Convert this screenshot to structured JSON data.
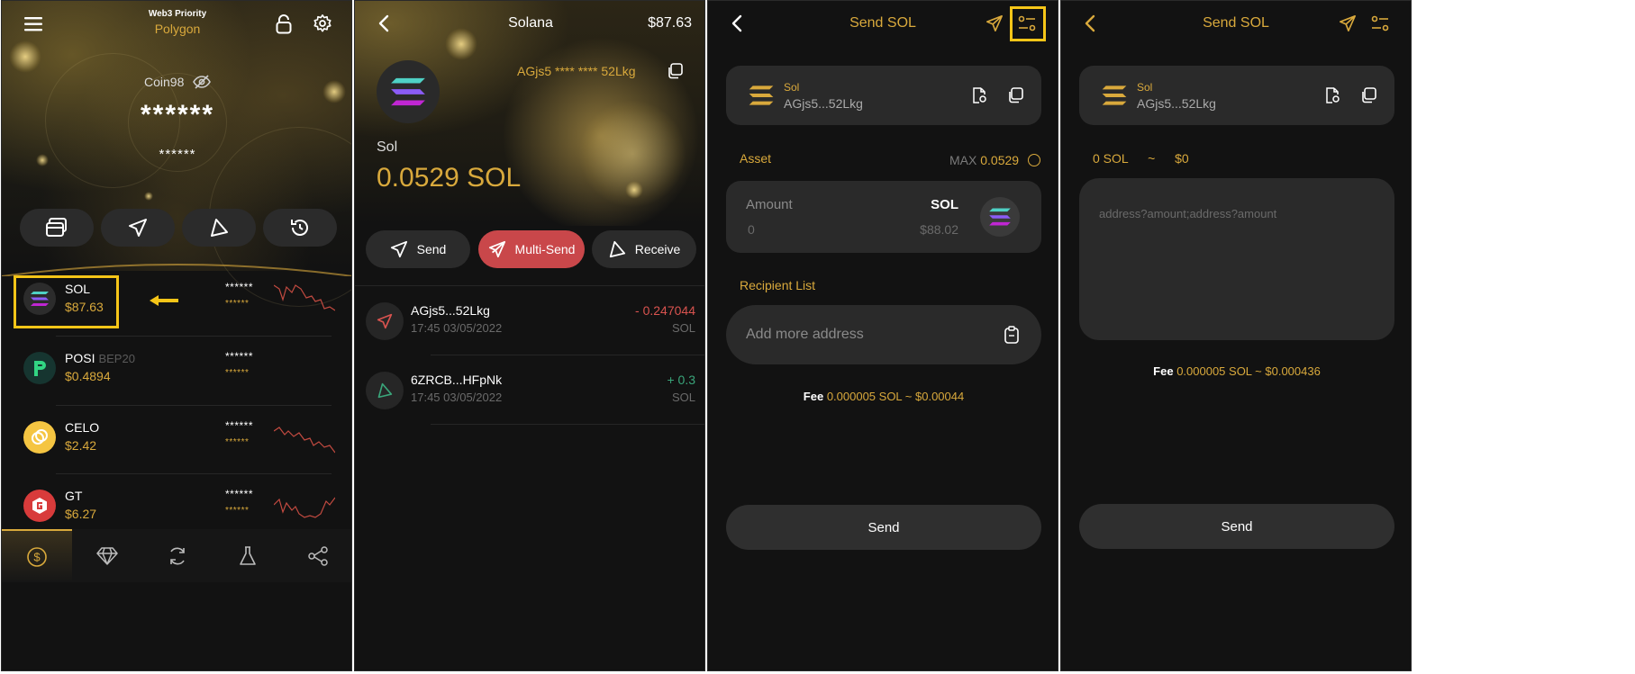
{
  "panel1": {
    "header": {
      "subtitle": "Web3 Priority",
      "network": "Polygon"
    },
    "wallet_name": "Coin98",
    "balance_main": "******",
    "balance_sub": "******",
    "coins": [
      {
        "symbol": "SOL",
        "tag": "",
        "price": "$87.63",
        "bal": "******",
        "bal_usd": "******"
      },
      {
        "symbol": "POSI",
        "tag": "BEP20",
        "price": "$0.4894",
        "bal": "******",
        "bal_usd": "******"
      },
      {
        "symbol": "CELO",
        "tag": "",
        "price": "$2.42",
        "bal": "******",
        "bal_usd": "******"
      },
      {
        "symbol": "GT",
        "tag": "",
        "price": "$6.27",
        "bal": "******",
        "bal_usd": "******"
      }
    ],
    "nav_icons": [
      "dollar-icon",
      "diamond-icon",
      "refresh-icon",
      "flask-icon",
      "share-icon"
    ]
  },
  "panel2": {
    "title": "Solana",
    "title_value": "$87.63",
    "address": "AGjs5 **** **** 52Lkg",
    "token_name": "Sol",
    "token_balance": "0.0529 SOL",
    "actions": {
      "send": "Send",
      "multi_send": "Multi-Send",
      "receive": "Receive"
    },
    "transactions": [
      {
        "address": "AGjs5...52Lkg",
        "time": "17:45 03/05/2022",
        "amount": "- 0.247044",
        "unit": "SOL",
        "type": "send"
      },
      {
        "address": "6ZRCB...HFpNk",
        "time": "17:45 03/05/2022",
        "amount": "+ 0.3",
        "unit": "SOL",
        "type": "receive"
      }
    ]
  },
  "panel3": {
    "title": "Send SOL",
    "wallet": {
      "name": "Sol",
      "address": "AGjs5...52Lkg"
    },
    "asset_label": "Asset",
    "max_label": "MAX",
    "max_value": "0.0529",
    "amount_label": "Amount",
    "amount_value": "0",
    "amount_symbol": "SOL",
    "amount_usd": "$88.02",
    "recipient_label": "Recipient List",
    "recipient_placeholder": "Add more address",
    "fee_label": "Fee",
    "fee_value": "0.000005 SOL ~ $0.00044",
    "send_label": "Send"
  },
  "panel4": {
    "title": "Send SOL",
    "wallet": {
      "name": "Sol",
      "address": "AGjs5...52Lkg"
    },
    "total_sol": "0 SOL",
    "tilde": "~",
    "total_usd": "$0",
    "textarea_placeholder": "address?amount;address?amount",
    "fee_label": "Fee",
    "fee_value": "0.000005 SOL ~ $0.000436",
    "send_label": "Send"
  },
  "colors": {
    "gold": "#d9a93c",
    "red": "#d9534f",
    "green": "#3aa57a",
    "highlight": "#f5c518",
    "multisend": "#c9474a"
  }
}
